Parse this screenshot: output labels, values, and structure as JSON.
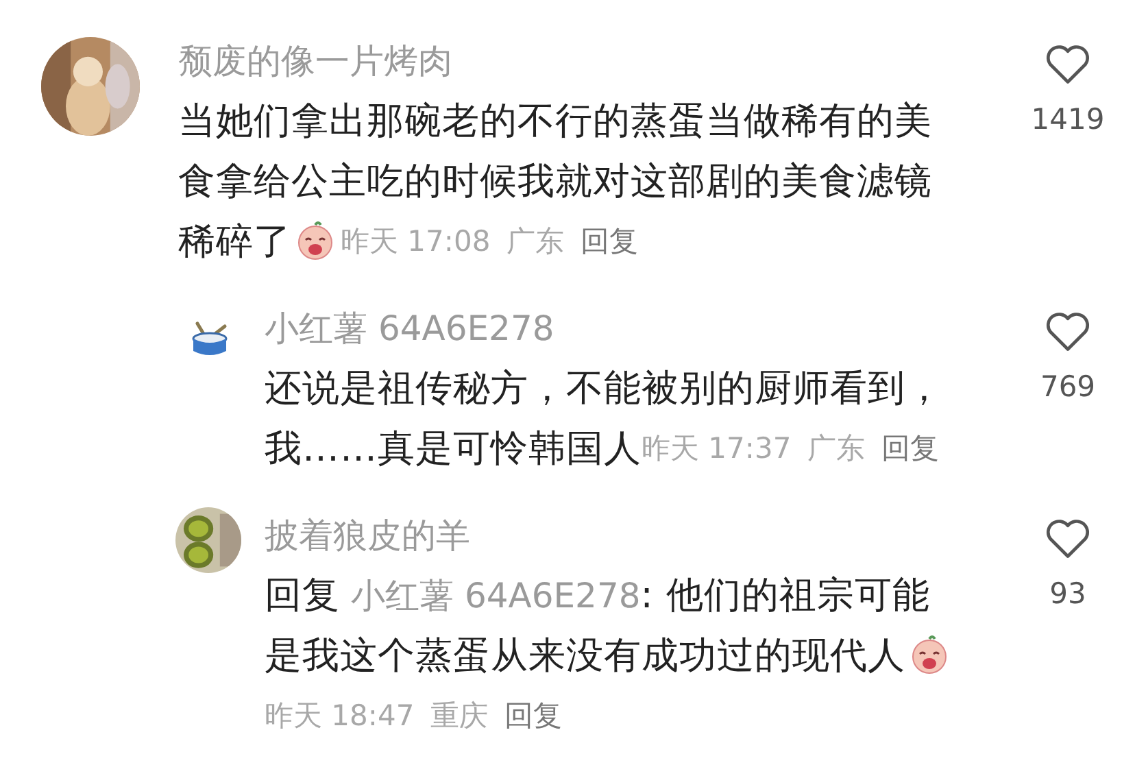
{
  "comments": [
    {
      "author": "颓废的像一片烤肉",
      "avatar": {
        "kind": "picture"
      },
      "lines": [
        "当她们拿出那碗老的不行的蒸蛋当做稀有的美",
        "食拿给公主吃的时候我就对这部剧的美食滤镜",
        "稀碎了"
      ],
      "sticker": true,
      "time": "昨天 17:08",
      "location": "广东",
      "reply_label": "回复",
      "likes": "1419",
      "replies": [
        {
          "author": "小红薯 64A6E278",
          "avatar": {
            "kind": "drum"
          },
          "lines": [
            "还说是祖传秘方，不能被别的厨师看到，",
            "我……真是可怜韩国人"
          ],
          "time": "昨天 17:37",
          "location": "广东",
          "reply_label": "回复",
          "likes": "769"
        },
        {
          "author": "披着狼皮的羊",
          "avatar": {
            "kind": "picture"
          },
          "reply_to": {
            "prefix": "回复",
            "mention": "小红薯 64A6E278"
          },
          "lines": [
            ": 他们的祖宗可能",
            "是我这个蒸蛋从来没有成功过的现代人"
          ],
          "sticker": true,
          "meta_own_line": true,
          "time": "昨天 18:47",
          "location": "重庆",
          "reply_label": "回复",
          "likes": "93"
        }
      ]
    }
  ]
}
